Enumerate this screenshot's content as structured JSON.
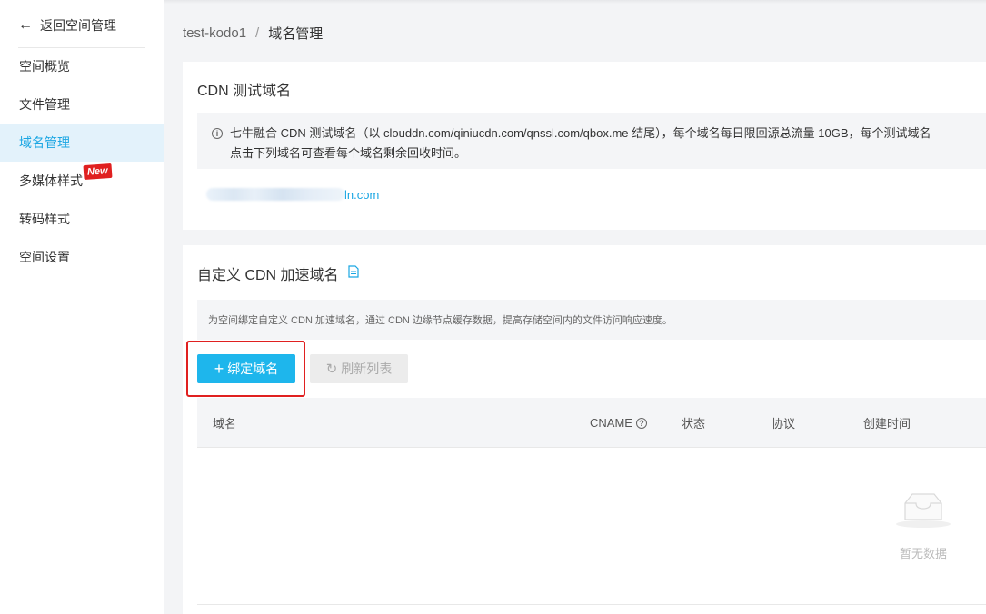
{
  "sidebar": {
    "back_label": "返回空间管理",
    "items": [
      {
        "label": "空间概览",
        "active": false
      },
      {
        "label": "文件管理",
        "active": false
      },
      {
        "label": "域名管理",
        "active": true
      },
      {
        "label": "多媒体样式",
        "active": false,
        "badge": "New"
      },
      {
        "label": "转码样式",
        "active": false
      },
      {
        "label": "空间设置",
        "active": false
      }
    ]
  },
  "breadcrumb": {
    "bucket": "test-kodo1",
    "separator": "/",
    "current": "域名管理"
  },
  "cdn_test": {
    "title": "CDN 测试域名",
    "notice_line1": "七牛融合 CDN 测试域名（以 clouddn.com/qiniucdn.com/qnssl.com/qbox.me 结尾），每个域名每日限回源总流量 10GB，每个测试域名",
    "notice_line2": "点击下列域名可查看每个域名剩余回收时间。",
    "domain_suffix": "ln.com"
  },
  "custom_cdn": {
    "title": "自定义 CDN 加速域名",
    "description": "为空间绑定自定义 CDN 加速域名，通过 CDN 边缘节点缓存数据，提高存储空间内的文件访问响应速度。",
    "bind_button": "绑定域名",
    "refresh_button": "刷新列表",
    "columns": {
      "domain": "域名",
      "cname": "CNAME",
      "status": "状态",
      "protocol": "协议",
      "created": "创建时间"
    },
    "empty_text": "暂无数据"
  },
  "colors": {
    "accent": "#1eb6ec",
    "link": "#1aa6e3",
    "highlight": "#e02020"
  }
}
